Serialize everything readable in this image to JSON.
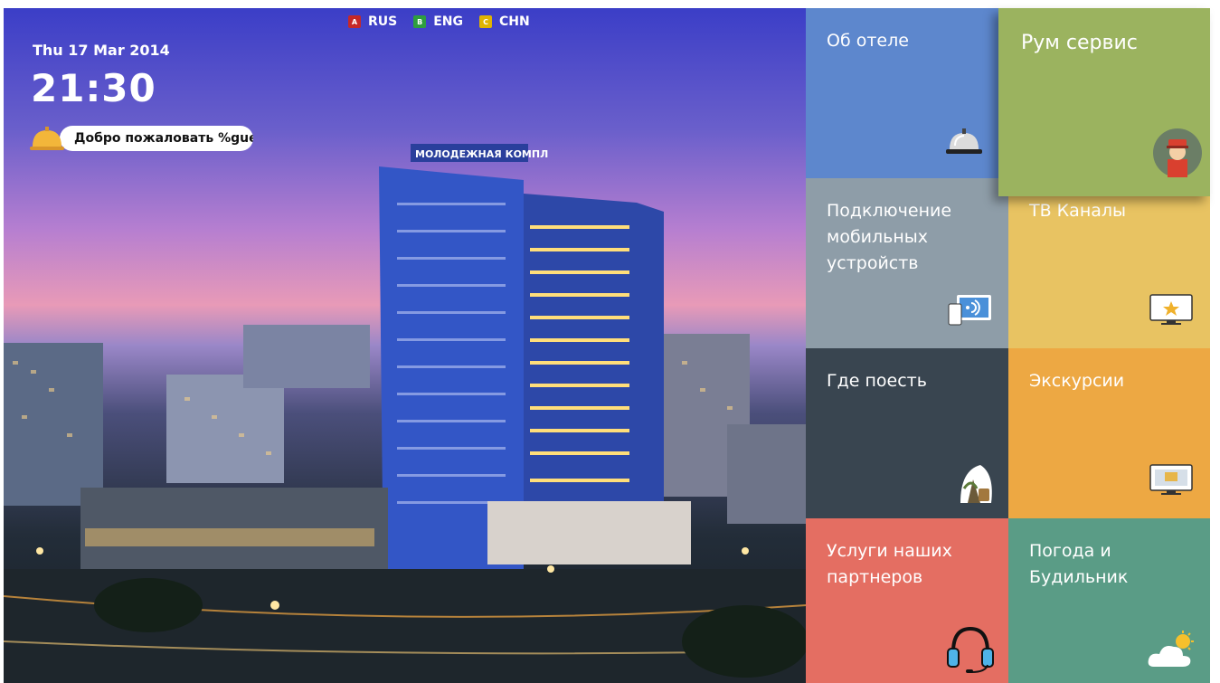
{
  "languages": [
    {
      "key": "A",
      "label": "RUS",
      "color": "#c62828"
    },
    {
      "key": "B",
      "label": "ENG",
      "color": "#2e9e3e"
    },
    {
      "key": "C",
      "label": "CHN",
      "color": "#e0b400"
    }
  ],
  "header": {
    "date": "Thu 17 Mar 2014",
    "time": "21:30",
    "welcome": "Добро пожаловать %guestname%"
  },
  "photo": {
    "building_sign": "МОЛОДЕЖНАЯ КОМПЛ"
  },
  "tiles": {
    "about": {
      "label": "Об отеле",
      "icon": "service-bell-icon"
    },
    "room_service": {
      "label": "Рум сервис",
      "icon": "bellboy-icon"
    },
    "mobile": {
      "label": "Подключение\nмобильных\nустройств",
      "icon": "mobile-connect-icon"
    },
    "tv": {
      "label": "ТВ Каналы",
      "icon": "tv-star-icon"
    },
    "eat": {
      "label": "Где поесть",
      "icon": "dining-icon"
    },
    "excursions": {
      "label": "Экскурсии",
      "icon": "monitor-icon"
    },
    "partners": {
      "label": "Услуги наших\nпартнеров",
      "icon": "headset-icon"
    },
    "weather": {
      "label": "Погода и\nБудильник",
      "icon": "weather-icon"
    }
  }
}
